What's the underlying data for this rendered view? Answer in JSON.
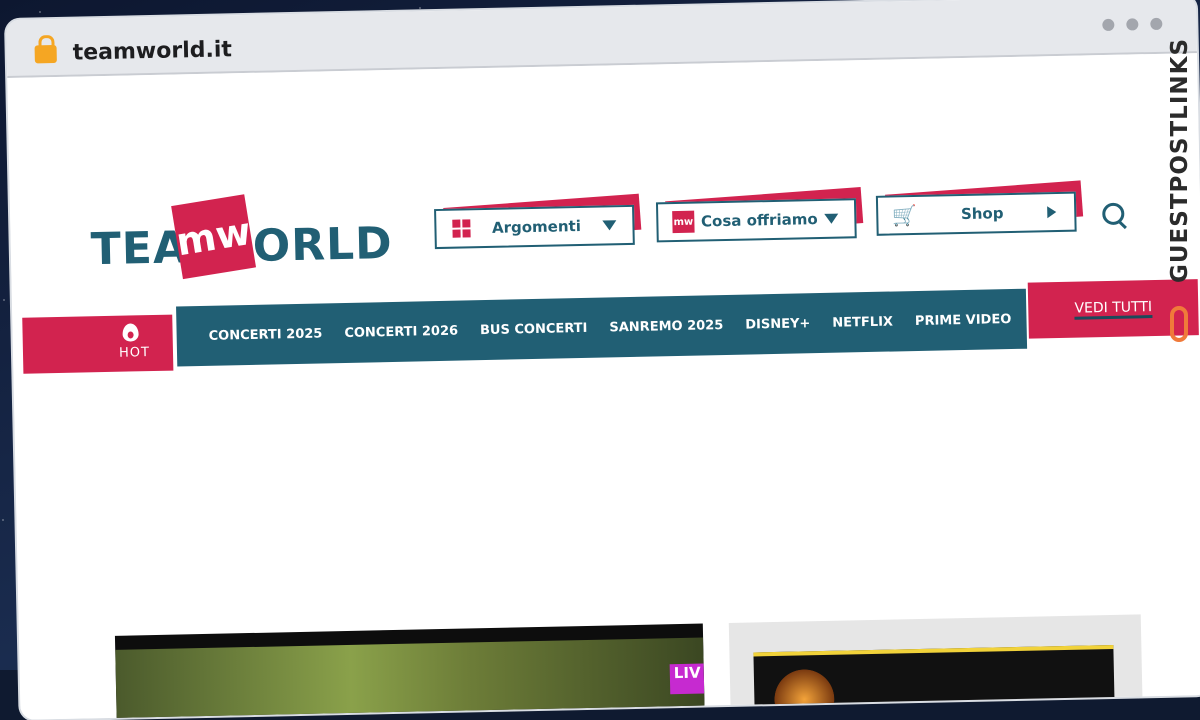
{
  "browser": {
    "url": "teamworld.it"
  },
  "logo": {
    "left_text": "TEA",
    "mark_text": "mw",
    "right_text": "ORLD"
  },
  "topbar": {
    "argomenti_label": "Argomenti",
    "cosa_label": "Cosa offriamo",
    "cosa_icon_text": "mw",
    "shop_label": "Shop"
  },
  "hot": {
    "label": "HOT"
  },
  "nav": {
    "items": [
      "CONCERTI 2025",
      "CONCERTI 2026",
      "BUS CONCERTI",
      "SANREMO 2025",
      "DISNEY+",
      "NETFLIX",
      "PRIME VIDEO"
    ],
    "more": "..."
  },
  "vedi": {
    "label": "VEDI TUTTI"
  },
  "cards": {
    "live_badge": "LIV"
  },
  "watermark": {
    "text": "GUESTPOSTLINKS"
  },
  "colors": {
    "brand_teal": "#215f74",
    "brand_pink": "#d2234f"
  }
}
